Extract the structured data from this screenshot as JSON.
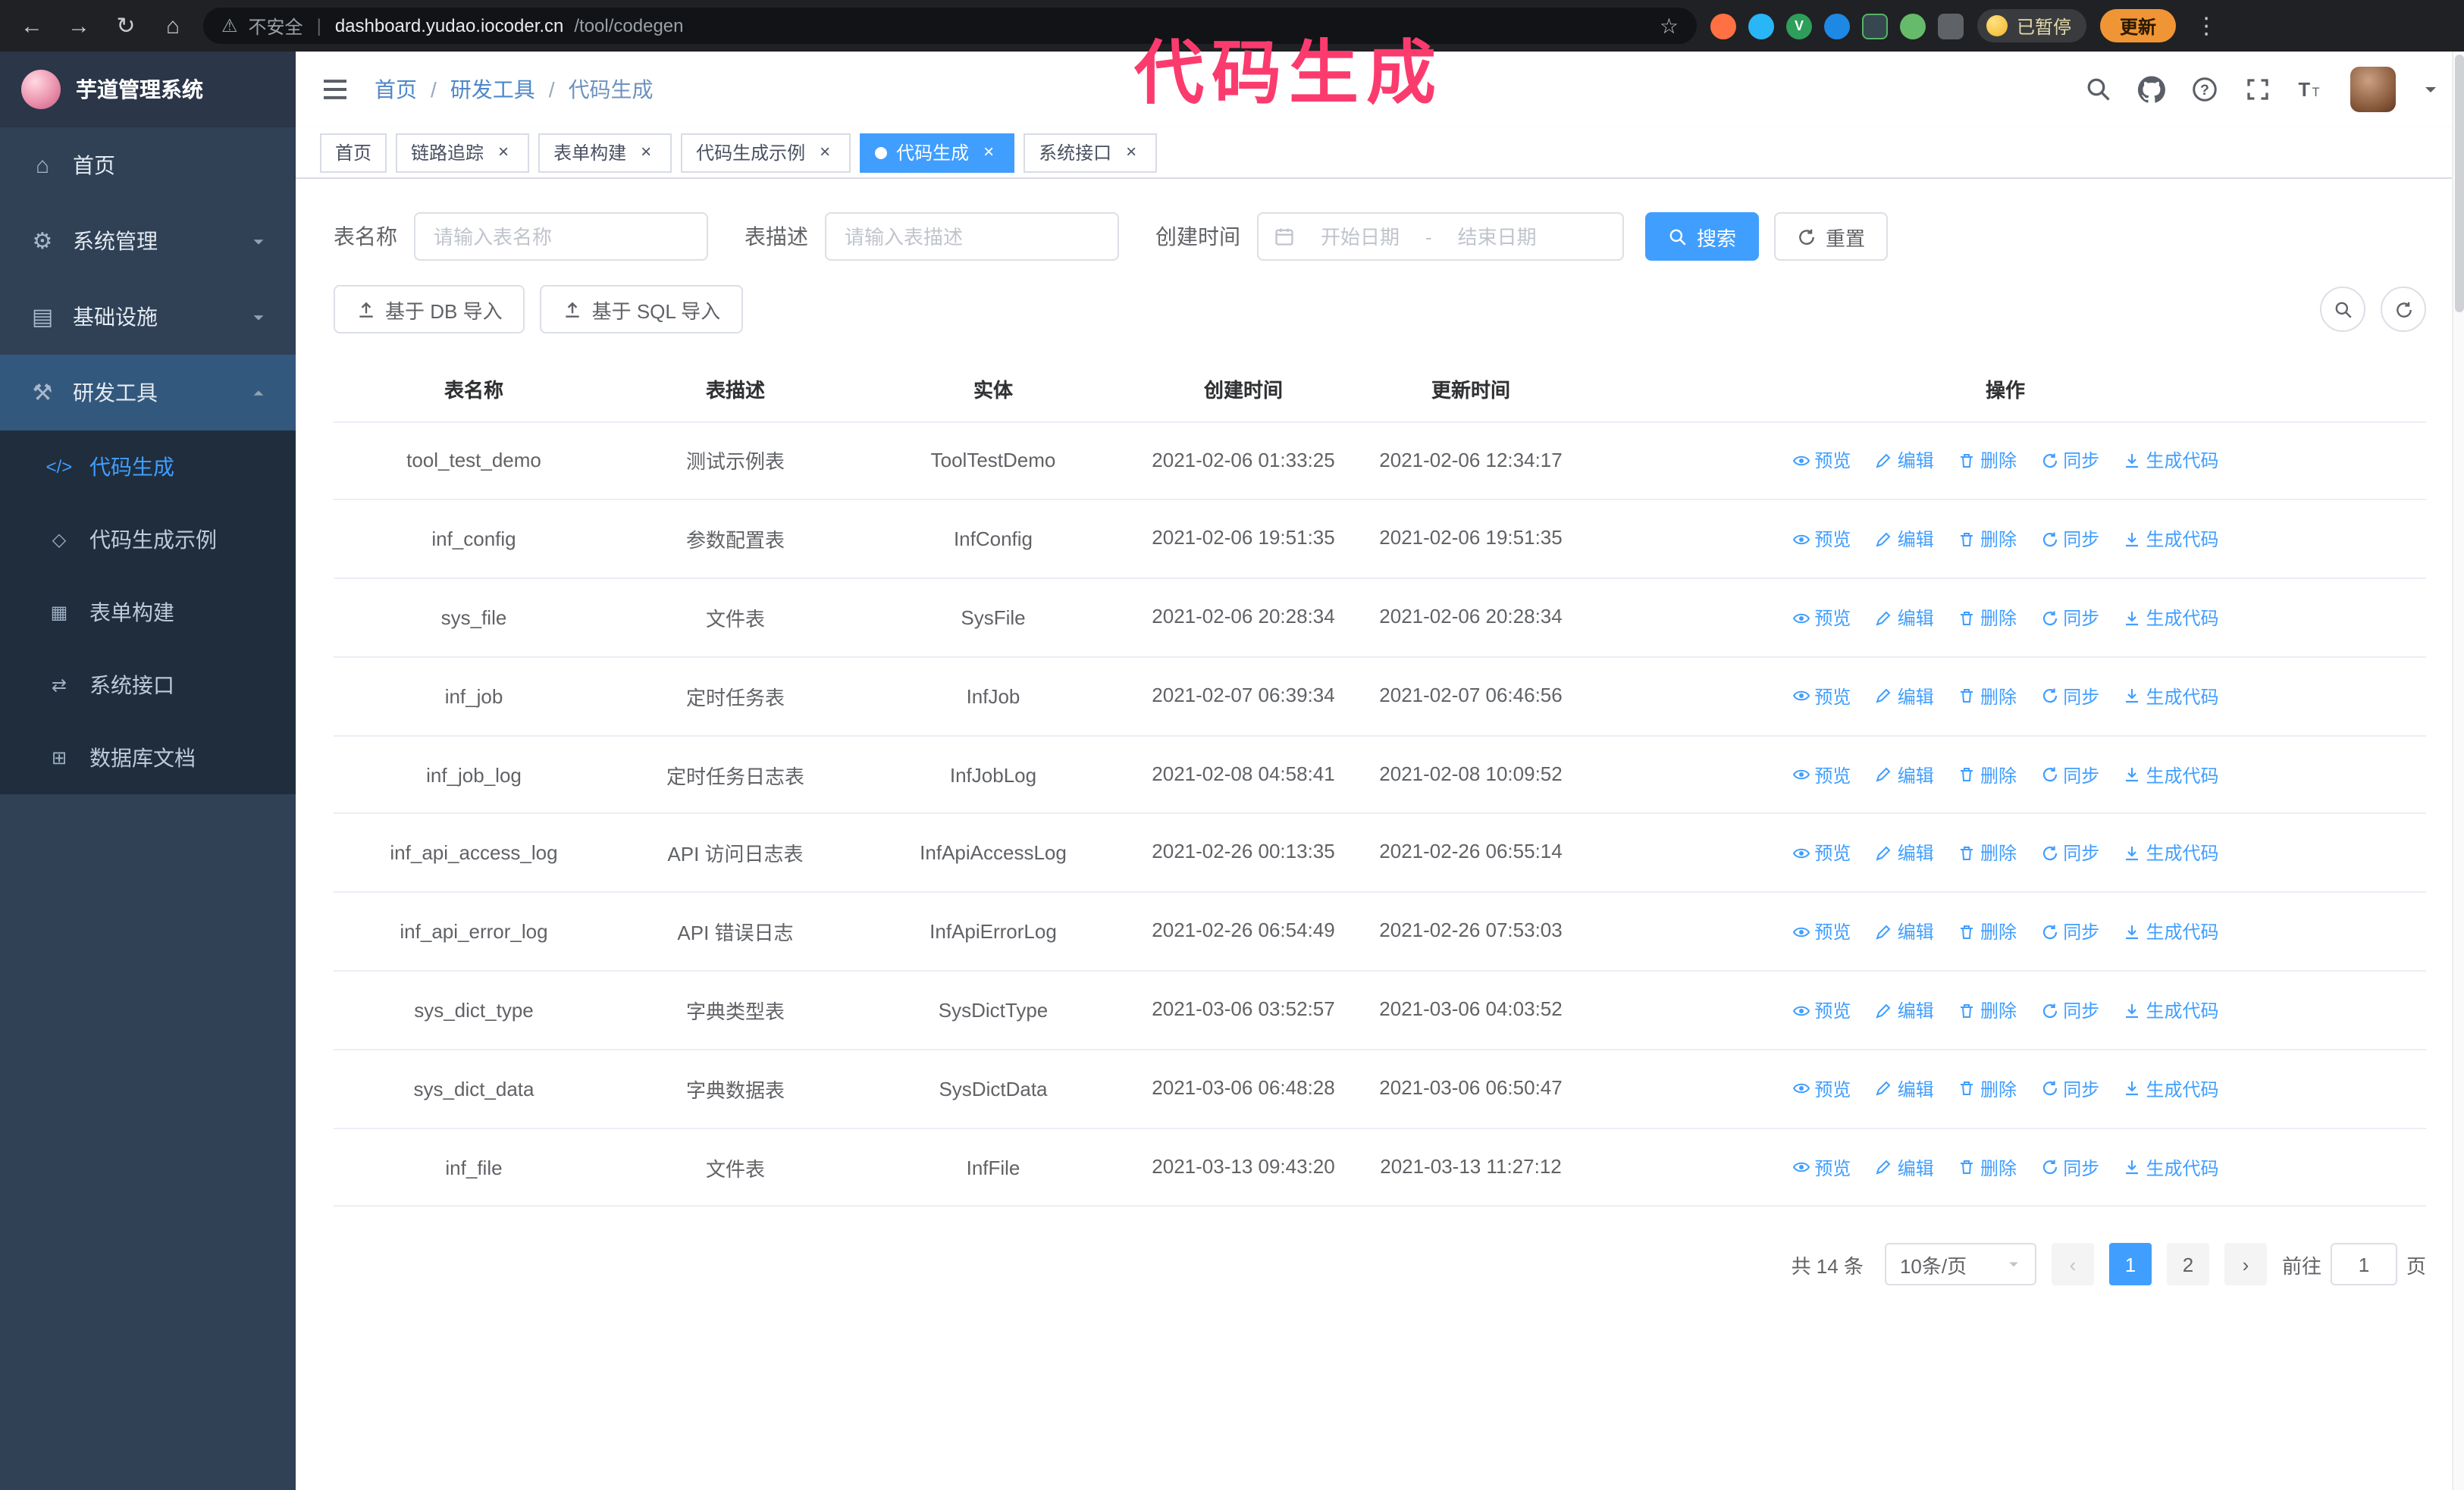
{
  "annotation": "代码生成",
  "colors": {
    "accent": "#409eff",
    "sidebar_bg": "#304156",
    "submenu_bg": "#1f2d3d",
    "annotation_pink": "#fb3b6e",
    "update_orange": "#f09536"
  },
  "glyphs": {
    "back": "←",
    "forward": "→",
    "reload": "↻",
    "home": "⌂",
    "warning": "⚠",
    "divider": "|",
    "star": "☆",
    "kebab": "⋮",
    "close": "×",
    "slash": "/",
    "prev": "‹",
    "next": "›",
    "ext_v": "V",
    "menu_home": "⌂",
    "menu_system": "⚙",
    "menu_infra": "▤",
    "menu_tools": "⚒",
    "menu_code": "</>",
    "menu_example": "◇",
    "menu_form": "▦",
    "menu_api": "⇄",
    "menu_db": "⊞"
  },
  "browser": {
    "security_warning": "不安全",
    "url_host": "dashboard.yudao.iocoder.cn",
    "url_path": "/tool/codegen",
    "paused_badge": "已暂停",
    "update_button": "更新"
  },
  "sidebar": {
    "title": "芋道管理系统",
    "items": [
      {
        "label": "首页"
      },
      {
        "label": "系统管理"
      },
      {
        "label": "基础设施"
      },
      {
        "label": "研发工具"
      }
    ],
    "submenu": [
      {
        "label": "代码生成"
      },
      {
        "label": "代码生成示例"
      },
      {
        "label": "表单构建"
      },
      {
        "label": "系统接口"
      },
      {
        "label": "数据库文档"
      }
    ]
  },
  "header": {
    "breadcrumb": [
      "首页",
      "研发工具",
      "代码生成"
    ]
  },
  "tabs": {
    "items": [
      {
        "label": "首页"
      },
      {
        "label": "链路追踪"
      },
      {
        "label": "表单构建"
      },
      {
        "label": "代码生成示例"
      },
      {
        "label": "代码生成"
      },
      {
        "label": "系统接口"
      }
    ]
  },
  "filters": {
    "name_label": "表名称",
    "name_placeholder": "请输入表名称",
    "desc_label": "表描述",
    "desc_placeholder": "请输入表描述",
    "time_label": "创建时间",
    "start_placeholder": "开始日期",
    "range_separator": "-",
    "end_placeholder": "结束日期",
    "search_button": "搜索",
    "reset_button": "重置"
  },
  "toolbar": {
    "import_db_button": "基于 DB 导入",
    "import_sql_button": "基于 SQL 导入"
  },
  "table": {
    "columns": [
      "表名称",
      "表描述",
      "实体",
      "创建时间",
      "更新时间",
      "操作"
    ],
    "action_labels": [
      "预览",
      "编辑",
      "删除",
      "同步",
      "生成代码"
    ],
    "rows": [
      {
        "name": "tool_test_demo",
        "desc": "测试示例表",
        "entity": "ToolTestDemo",
        "created": "2021-02-06 01:33:25",
        "updated": "2021-02-06 12:34:17"
      },
      {
        "name": "inf_config",
        "desc": "参数配置表",
        "entity": "InfConfig",
        "created": "2021-02-06 19:51:35",
        "updated": "2021-02-06 19:51:35"
      },
      {
        "name": "sys_file",
        "desc": "文件表",
        "entity": "SysFile",
        "created": "2021-02-06 20:28:34",
        "updated": "2021-02-06 20:28:34"
      },
      {
        "name": "inf_job",
        "desc": "定时任务表",
        "entity": "InfJob",
        "created": "2021-02-07 06:39:34",
        "updated": "2021-02-07 06:46:56"
      },
      {
        "name": "inf_job_log",
        "desc": "定时任务日志表",
        "entity": "InfJobLog",
        "created": "2021-02-08 04:58:41",
        "updated": "2021-02-08 10:09:52"
      },
      {
        "name": "inf_api_access_log",
        "desc": "API 访问日志表",
        "entity": "InfApiAccessLog",
        "created": "2021-02-26 00:13:35",
        "updated": "2021-02-26 06:55:14"
      },
      {
        "name": "inf_api_error_log",
        "desc": "API 错误日志",
        "entity": "InfApiErrorLog",
        "created": "2021-02-26 06:54:49",
        "updated": "2021-02-26 07:53:03"
      },
      {
        "name": "sys_dict_type",
        "desc": "字典类型表",
        "entity": "SysDictType",
        "created": "2021-03-06 03:52:57",
        "updated": "2021-03-06 04:03:52"
      },
      {
        "name": "sys_dict_data",
        "desc": "字典数据表",
        "entity": "SysDictData",
        "created": "2021-03-06 06:48:28",
        "updated": "2021-03-06 06:50:47"
      },
      {
        "name": "inf_file",
        "desc": "文件表",
        "entity": "InfFile",
        "created": "2021-03-13 09:43:20",
        "updated": "2021-03-13 11:27:12"
      }
    ]
  },
  "pagination": {
    "total": "共 14 条",
    "page_size": "10条/页",
    "pages": [
      "1",
      "2"
    ],
    "goto_label": "前往",
    "goto_value": "1",
    "goto_unit": "页"
  }
}
